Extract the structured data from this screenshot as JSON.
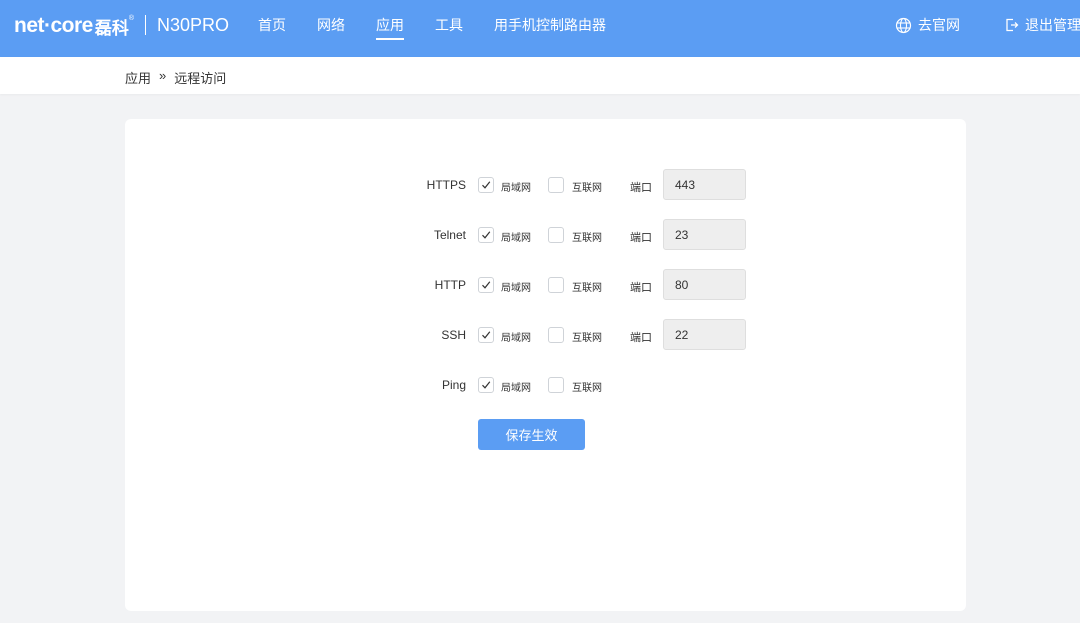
{
  "header": {
    "logo_text": "net·core",
    "logo_cn": "磊科",
    "logo_reg": "®",
    "model": "N30PRO",
    "nav": [
      {
        "label": "首页"
      },
      {
        "label": "网络"
      },
      {
        "label": "应用",
        "active": true
      },
      {
        "label": "工具"
      },
      {
        "label": "用手机控制路由器"
      }
    ],
    "website_label": "去官网",
    "website_icon": "globe-icon",
    "logout_label": "退出管理",
    "logout_icon": "logout-icon",
    "accent_color": "#5b9df3"
  },
  "breadcrumb": {
    "parent": "应用",
    "separator": "»",
    "current": "远程访问"
  },
  "form": {
    "lan_label": "局域网",
    "wan_label": "互联网",
    "port_label": "端口",
    "rows": [
      {
        "protocol": "HTTPS",
        "lan": true,
        "wan": false,
        "port": "443"
      },
      {
        "protocol": "Telnet",
        "lan": true,
        "wan": false,
        "port": "23"
      },
      {
        "protocol": "HTTP",
        "lan": true,
        "wan": false,
        "port": "80"
      },
      {
        "protocol": "SSH",
        "lan": true,
        "wan": false,
        "port": "22"
      },
      {
        "protocol": "Ping",
        "lan": true,
        "wan": false,
        "port": null
      }
    ],
    "save_label": "保存生效"
  }
}
